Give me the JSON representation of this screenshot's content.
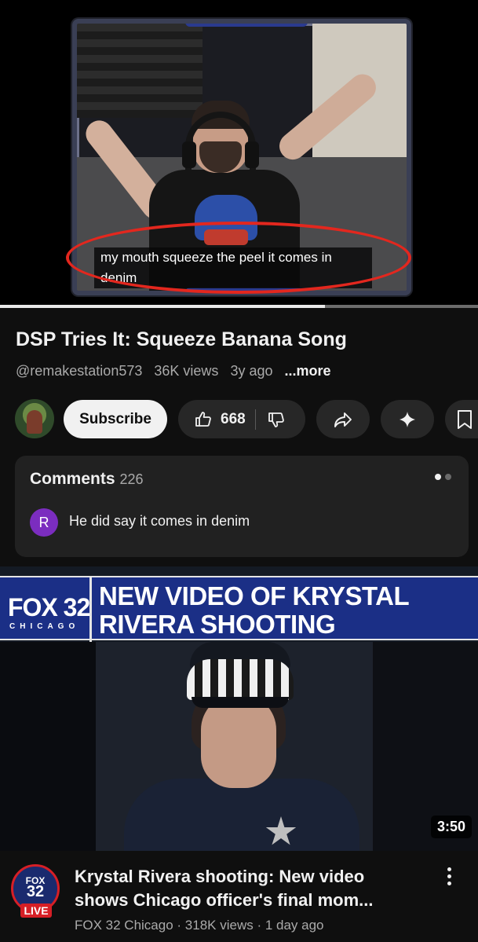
{
  "player": {
    "caption": "my mouth squeeze the peel it comes in denim",
    "progress_fraction": 0.68
  },
  "video": {
    "title": "DSP Tries It: Squeeze Banana Song",
    "channel_handle": "@remakestation573",
    "views": "36K views",
    "age": "3y ago",
    "more": "...more"
  },
  "actions": {
    "subscribe": "Subscribe",
    "likes": "668"
  },
  "comments": {
    "title": "Comments",
    "count": "226",
    "top_comment": {
      "avatar_letter": "R",
      "text": "He did say it comes in denim"
    }
  },
  "next_video": {
    "banner_brand": "FOX 32",
    "banner_city": "CHICAGO",
    "banner_headline_1": "NEW VIDEO OF KRYSTAL",
    "banner_headline_2": "RIVERA SHOOTING",
    "duration": "3:50",
    "channel_logo_top": "FOX",
    "channel_logo_num": "32",
    "live_badge": "LIVE",
    "title": "Krystal Rivera shooting: New video shows Chicago officer's final mom...",
    "meta": "FOX 32 Chicago · 318K views · 1 day ago"
  },
  "colors": {
    "background": "#0f0f0f",
    "annotation_ellipse": "#e3271e",
    "comment_avatar": "#7b2dbf",
    "fox_blue": "#1b2f86",
    "live_red": "#d61f26"
  },
  "icons": [
    "thumbs-up-icon",
    "thumbs-down-icon",
    "share-icon",
    "sparkle-icon",
    "bookmark-icon",
    "more-vert-icon"
  ]
}
